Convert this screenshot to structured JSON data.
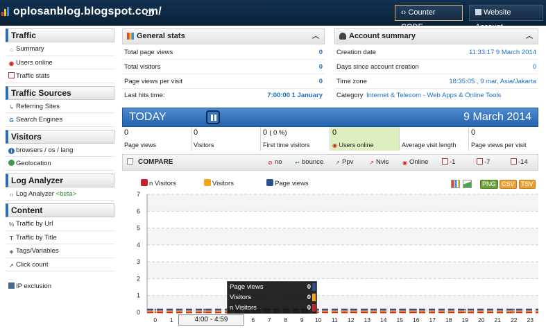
{
  "header": {
    "site_title": "oplosanblog.blogspot.com/",
    "counter_code_label": "Counter CODE",
    "website_account_label": "Website Account",
    "code_icon": "‹›",
    "account_icon": "account-icon"
  },
  "sidebar": {
    "sections": [
      {
        "title": "Traffic",
        "items": [
          "Summary",
          "Users online",
          "Traffic stats"
        ]
      },
      {
        "title": "Traffic Sources",
        "items": [
          "Referring Sites",
          "Search Engines"
        ]
      },
      {
        "title": "Visitors",
        "items": [
          "browsers / os / lang",
          "Geolocation"
        ]
      },
      {
        "title": "Log Analyzer",
        "items": [
          "Log Analyzer",
          "<beta>"
        ]
      },
      {
        "title": "Content",
        "items": [
          "Traffic by Url",
          "Traffic by Title",
          "Tags/Variables",
          "Click count"
        ]
      }
    ],
    "ip_exclusion": "IP exclusion"
  },
  "general_stats": {
    "title": "General stats",
    "rows": [
      {
        "label": "Total page views",
        "value": "0"
      },
      {
        "label": "Total visitors",
        "value": "0"
      },
      {
        "label": "Page views per visit",
        "value": "0"
      },
      {
        "label": "Last hits time:",
        "value": "7:00:00 1 January"
      }
    ]
  },
  "account_summary": {
    "title": "Account summary",
    "rows": [
      {
        "label": "Creation date",
        "value": "11:33:17 9 March 2014"
      },
      {
        "label": "Days since account creation",
        "value": "0"
      },
      {
        "label": "Time zone",
        "value": "18:35:05 , 9 mar, Asia/Jakarta"
      },
      {
        "label": "Category",
        "value": "Internet & Telecom - Web Apps & Online Tools"
      }
    ]
  },
  "today": {
    "label": "TODAY",
    "date": "9 March 2014",
    "cells": [
      {
        "num": "0",
        "cap": "Page views"
      },
      {
        "num": "0",
        "cap": "Visitors"
      },
      {
        "num": "0",
        "num_extra": "( 0 %)",
        "cap": "First time visitors"
      },
      {
        "num": "0",
        "cap": "Users online"
      },
      {
        "num": "",
        "cap": "Average visit length"
      },
      {
        "num": "0",
        "cap": "Page views per visit"
      }
    ]
  },
  "compare": {
    "label": "COMPARE",
    "options": [
      "no",
      "bounce",
      "Ppv",
      "Nvis",
      "Online",
      "-1",
      "-7",
      "-14"
    ]
  },
  "chart_data": {
    "type": "line",
    "x": [
      0,
      1,
      2,
      3,
      4,
      5,
      6,
      7,
      8,
      9,
      10,
      11,
      12,
      13,
      14,
      15,
      16,
      17,
      18,
      19,
      20,
      21,
      22,
      23
    ],
    "series": [
      {
        "name": "n Visitors",
        "color": "#c8232c",
        "values": [
          0,
          0,
          0,
          0,
          0,
          0,
          0,
          0,
          0,
          0,
          0,
          0,
          0,
          0,
          0,
          0,
          0,
          0,
          0,
          0,
          0,
          0,
          0,
          0
        ]
      },
      {
        "name": "Visitors",
        "color": "#f3a51f",
        "values": [
          0,
          0,
          0,
          0,
          0,
          0,
          0,
          0,
          0,
          0,
          0,
          0,
          0,
          0,
          0,
          0,
          0,
          0,
          0,
          0,
          0,
          0,
          0,
          0
        ]
      },
      {
        "name": "Page views",
        "color": "#2b4f8e",
        "values": [
          0,
          0,
          0,
          0,
          0,
          0,
          0,
          0,
          0,
          0,
          0,
          0,
          0,
          0,
          0,
          0,
          0,
          0,
          0,
          0,
          0,
          0,
          0,
          0
        ]
      }
    ],
    "yticks": [
      "0",
      "1",
      "2",
      "3",
      "4",
      "5",
      "6",
      "7"
    ],
    "ylim": [
      0,
      7
    ],
    "grid": true,
    "highlight_label": "4:00 - 4:59",
    "tooltip": [
      {
        "label": "Page views",
        "value": "0",
        "color": "#2b4f8e"
      },
      {
        "label": "Visitors",
        "value": "0",
        "color": "#f3a51f"
      },
      {
        "label": "n Visitors",
        "value": "0",
        "color": "#c8232c"
      }
    ]
  },
  "export": {
    "png": "PNG",
    "csv": "CSV",
    "tsv": "TSV"
  }
}
